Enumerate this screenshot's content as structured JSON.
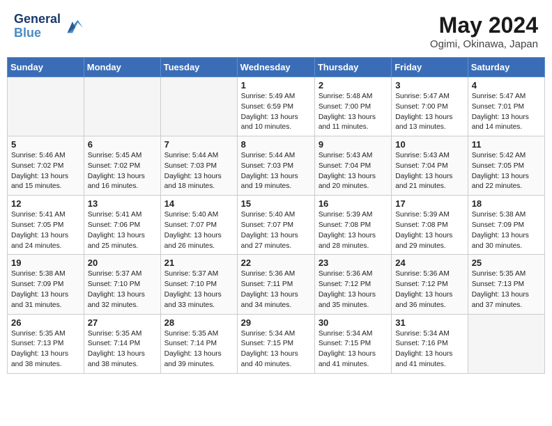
{
  "header": {
    "logo_line1": "General",
    "logo_line2": "Blue",
    "month": "May 2024",
    "location": "Ogimi, Okinawa, Japan"
  },
  "weekdays": [
    "Sunday",
    "Monday",
    "Tuesday",
    "Wednesday",
    "Thursday",
    "Friday",
    "Saturday"
  ],
  "weeks": [
    [
      {
        "day": "",
        "info": ""
      },
      {
        "day": "",
        "info": ""
      },
      {
        "day": "",
        "info": ""
      },
      {
        "day": "1",
        "info": "Sunrise: 5:49 AM\nSunset: 6:59 PM\nDaylight: 13 hours\nand 10 minutes."
      },
      {
        "day": "2",
        "info": "Sunrise: 5:48 AM\nSunset: 7:00 PM\nDaylight: 13 hours\nand 11 minutes."
      },
      {
        "day": "3",
        "info": "Sunrise: 5:47 AM\nSunset: 7:00 PM\nDaylight: 13 hours\nand 13 minutes."
      },
      {
        "day": "4",
        "info": "Sunrise: 5:47 AM\nSunset: 7:01 PM\nDaylight: 13 hours\nand 14 minutes."
      }
    ],
    [
      {
        "day": "5",
        "info": "Sunrise: 5:46 AM\nSunset: 7:02 PM\nDaylight: 13 hours\nand 15 minutes."
      },
      {
        "day": "6",
        "info": "Sunrise: 5:45 AM\nSunset: 7:02 PM\nDaylight: 13 hours\nand 16 minutes."
      },
      {
        "day": "7",
        "info": "Sunrise: 5:44 AM\nSunset: 7:03 PM\nDaylight: 13 hours\nand 18 minutes."
      },
      {
        "day": "8",
        "info": "Sunrise: 5:44 AM\nSunset: 7:03 PM\nDaylight: 13 hours\nand 19 minutes."
      },
      {
        "day": "9",
        "info": "Sunrise: 5:43 AM\nSunset: 7:04 PM\nDaylight: 13 hours\nand 20 minutes."
      },
      {
        "day": "10",
        "info": "Sunrise: 5:43 AM\nSunset: 7:04 PM\nDaylight: 13 hours\nand 21 minutes."
      },
      {
        "day": "11",
        "info": "Sunrise: 5:42 AM\nSunset: 7:05 PM\nDaylight: 13 hours\nand 22 minutes."
      }
    ],
    [
      {
        "day": "12",
        "info": "Sunrise: 5:41 AM\nSunset: 7:05 PM\nDaylight: 13 hours\nand 24 minutes."
      },
      {
        "day": "13",
        "info": "Sunrise: 5:41 AM\nSunset: 7:06 PM\nDaylight: 13 hours\nand 25 minutes."
      },
      {
        "day": "14",
        "info": "Sunrise: 5:40 AM\nSunset: 7:07 PM\nDaylight: 13 hours\nand 26 minutes."
      },
      {
        "day": "15",
        "info": "Sunrise: 5:40 AM\nSunset: 7:07 PM\nDaylight: 13 hours\nand 27 minutes."
      },
      {
        "day": "16",
        "info": "Sunrise: 5:39 AM\nSunset: 7:08 PM\nDaylight: 13 hours\nand 28 minutes."
      },
      {
        "day": "17",
        "info": "Sunrise: 5:39 AM\nSunset: 7:08 PM\nDaylight: 13 hours\nand 29 minutes."
      },
      {
        "day": "18",
        "info": "Sunrise: 5:38 AM\nSunset: 7:09 PM\nDaylight: 13 hours\nand 30 minutes."
      }
    ],
    [
      {
        "day": "19",
        "info": "Sunrise: 5:38 AM\nSunset: 7:09 PM\nDaylight: 13 hours\nand 31 minutes."
      },
      {
        "day": "20",
        "info": "Sunrise: 5:37 AM\nSunset: 7:10 PM\nDaylight: 13 hours\nand 32 minutes."
      },
      {
        "day": "21",
        "info": "Sunrise: 5:37 AM\nSunset: 7:10 PM\nDaylight: 13 hours\nand 33 minutes."
      },
      {
        "day": "22",
        "info": "Sunrise: 5:36 AM\nSunset: 7:11 PM\nDaylight: 13 hours\nand 34 minutes."
      },
      {
        "day": "23",
        "info": "Sunrise: 5:36 AM\nSunset: 7:12 PM\nDaylight: 13 hours\nand 35 minutes."
      },
      {
        "day": "24",
        "info": "Sunrise: 5:36 AM\nSunset: 7:12 PM\nDaylight: 13 hours\nand 36 minutes."
      },
      {
        "day": "25",
        "info": "Sunrise: 5:35 AM\nSunset: 7:13 PM\nDaylight: 13 hours\nand 37 minutes."
      }
    ],
    [
      {
        "day": "26",
        "info": "Sunrise: 5:35 AM\nSunset: 7:13 PM\nDaylight: 13 hours\nand 38 minutes."
      },
      {
        "day": "27",
        "info": "Sunrise: 5:35 AM\nSunset: 7:14 PM\nDaylight: 13 hours\nand 38 minutes."
      },
      {
        "day": "28",
        "info": "Sunrise: 5:35 AM\nSunset: 7:14 PM\nDaylight: 13 hours\nand 39 minutes."
      },
      {
        "day": "29",
        "info": "Sunrise: 5:34 AM\nSunset: 7:15 PM\nDaylight: 13 hours\nand 40 minutes."
      },
      {
        "day": "30",
        "info": "Sunrise: 5:34 AM\nSunset: 7:15 PM\nDaylight: 13 hours\nand 41 minutes."
      },
      {
        "day": "31",
        "info": "Sunrise: 5:34 AM\nSunset: 7:16 PM\nDaylight: 13 hours\nand 41 minutes."
      },
      {
        "day": "",
        "info": ""
      }
    ]
  ]
}
